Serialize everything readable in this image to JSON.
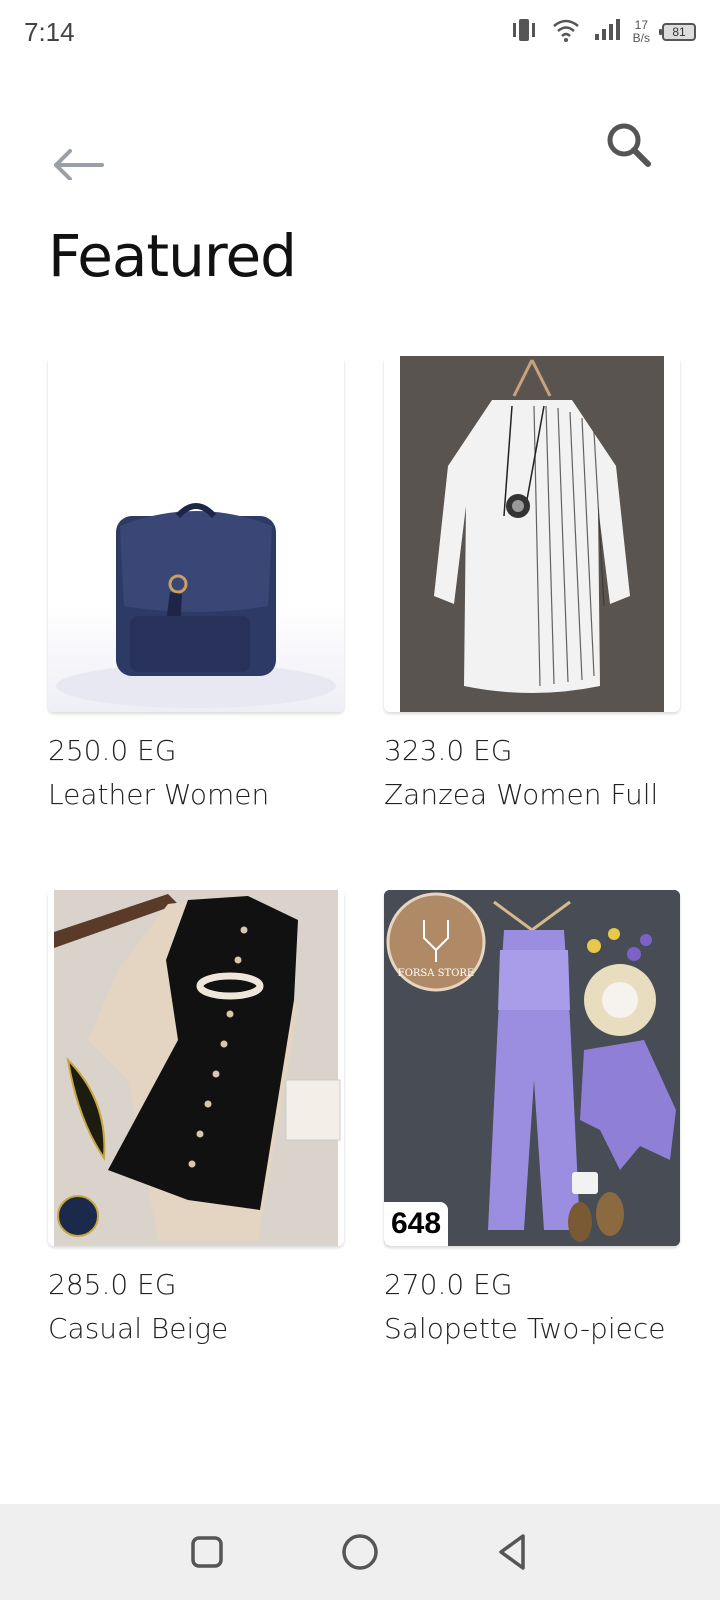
{
  "status_bar": {
    "time": "7:14",
    "net_speed_value": "17",
    "net_speed_unit": "B/s",
    "battery": "81"
  },
  "header": {
    "back_icon": "arrow-left-icon",
    "search_icon": "search-icon"
  },
  "page": {
    "title": "Featured"
  },
  "products": [
    {
      "price": "250.0 EG",
      "name": "Leather Women",
      "image": "navy-backpack"
    },
    {
      "price": "323.0 EG",
      "name": "Zanzea Women Full",
      "image": "striped-shirt"
    },
    {
      "price": "285.0 EG",
      "name": "Casual Beige",
      "image": "beige-dress"
    },
    {
      "price": "270.0 EG",
      "name": "Salopette Two-piece",
      "image": "purple-jumpsuit",
      "badge": "648",
      "logo_text": "FORSA STORE"
    }
  ],
  "nav_bar": {
    "recent_icon": "square-icon",
    "home_icon": "circle-icon",
    "back_icon": "triangle-back-icon"
  },
  "colors": {
    "background": "#ffffff",
    "nav_bar": "#efefef",
    "text": "#222222",
    "icon_gray": "#9aa0a8"
  }
}
